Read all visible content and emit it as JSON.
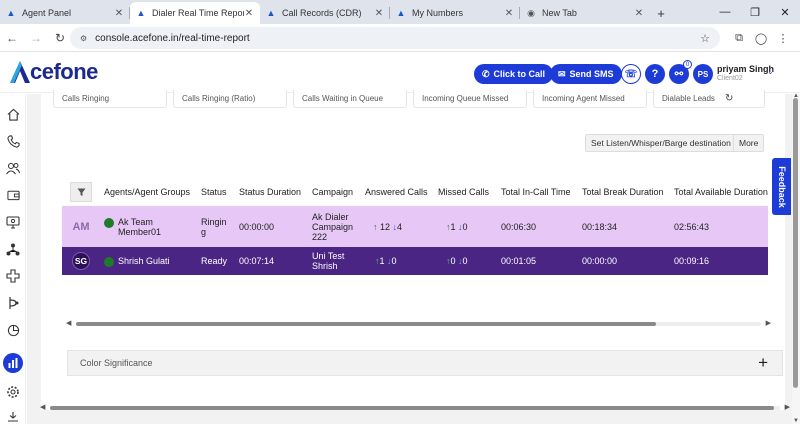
{
  "browser": {
    "tabs": [
      {
        "label": "Agent Panel",
        "icon": "acefone-icon",
        "active": false
      },
      {
        "label": "Dialer Real Time Report",
        "icon": "acefone-icon",
        "active": true
      },
      {
        "label": "Call Records (CDR)",
        "icon": "acefone-icon",
        "active": false
      },
      {
        "label": "My Numbers",
        "icon": "acefone-icon",
        "active": false
      },
      {
        "label": "New Tab",
        "icon": "chrome-icon",
        "active": false
      }
    ],
    "url": "console.acefone.in/real-time-report"
  },
  "header": {
    "logo_text": "cefone",
    "click_to_call": "Click to Call",
    "send_sms": "Send SMS",
    "help": "?",
    "notification_count": "0",
    "user_initials": "PS",
    "user_name": "priyam Singh",
    "user_id": "Client02"
  },
  "kpis": [
    {
      "label": "Calls Ringing"
    },
    {
      "label": "Calls Ringing (Ratio)"
    },
    {
      "label": "Calls Waiting in Queue"
    },
    {
      "label": "Incoming Queue Missed"
    },
    {
      "label": "Incoming Agent Missed"
    },
    {
      "label": "Dialable Leads"
    }
  ],
  "actions": {
    "listen": "Set Listen/Whisper/Barge destination",
    "more": "More"
  },
  "table": {
    "headers": [
      "Agents/Agent Groups",
      "Status",
      "Status Duration",
      "Campaign",
      "Answered Calls",
      "Missed Calls",
      "Total In-Call Time",
      "Total Break Duration",
      "Total Available Duration"
    ],
    "rows": [
      {
        "initials": "AM",
        "agent": "Ak Team Member01",
        "status": "Ringing",
        "status_duration": "00:00:00",
        "campaign": "Ak Dialer Campaign 222",
        "answered_up": "12",
        "answered_down": "4",
        "missed_up": "1",
        "missed_down": "0",
        "in_call": "00:06:30",
        "break": "00:18:34",
        "available": "02:56:43"
      },
      {
        "initials": "SG",
        "agent": "Shrish Gulati",
        "status": "Ready",
        "status_duration": "00:07:14",
        "campaign": "Uni Test Shrish",
        "answered_up": "1",
        "answered_down": "0",
        "missed_up": "0",
        "missed_down": "0",
        "in_call": "00:01:05",
        "break": "00:00:00",
        "available": "00:09:16"
      }
    ]
  },
  "color_significance": {
    "label": "Color Significance",
    "toggle": "+"
  },
  "feedback": "Feedback",
  "colors": {
    "brand": "#1d3bd6",
    "row_ringing": "#e7c7f5",
    "row_ready": "#4a2584",
    "status_online": "#1c7c2a"
  }
}
